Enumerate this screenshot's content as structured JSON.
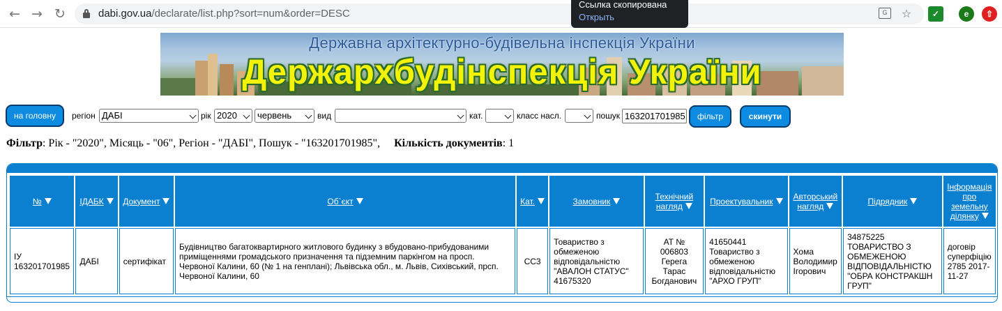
{
  "browser": {
    "url_host": "dabi.gov.ua",
    "url_path": "/declarate/list.php?sort=num&order=DESC",
    "toast_title": "Ссылка скопирована",
    "toast_action": "Открыть",
    "profile_letter": "e"
  },
  "banner": {
    "subtitle": "Державна архітектурно-будівельна інспекція України",
    "title": "Держархбудінспекція України"
  },
  "filters": {
    "home_button": "на головну",
    "region_label": "регіон",
    "region_value": "ДАБІ",
    "year_label": "рік",
    "year_value": "2020",
    "month_value": "червень",
    "type_label": "вид",
    "type_value": "",
    "cat_label": "кат.",
    "cat_value": "",
    "class_label": "класс насл.",
    "class_value": "",
    "search_label": "пошук",
    "search_value": "163201701985",
    "filter_button": "фільтр",
    "reset_button": "скинути"
  },
  "summary": {
    "filter_label": "Фільтр",
    "filter_text": ": Рік - \"2020\", Місяць - \"06\", Регіон - \"ДАБІ\", Пошук - \"163201701985\",",
    "count_label": "Кількість документів",
    "count_text": ": 1"
  },
  "table": {
    "headers": {
      "num": "№",
      "idabk": "ІДАБК",
      "document": "Документ",
      "object": "Об`єкт",
      "cat": "Кат.",
      "customer": "Замовник",
      "tech_l1": "Технічний",
      "tech_l2": "нагляд",
      "designer": "Проектувальник",
      "author_l1": "Авторський",
      "author_l2": "нагляд",
      "contractor": "Підрядник",
      "land_l1": "Інформація",
      "land_l2": "про",
      "land_l3": "земельну",
      "land_l4": "ділянку"
    },
    "rows": [
      {
        "num_l1": "ІУ",
        "num_l2": "163201701985",
        "idabk": "ДАБІ",
        "document": "сертифікат",
        "object": "Будівництво багатоквартирного житлового будинку з вбудовано-прибудованими приміщеннями громадського призначення та підземним паркінгом на просп. Червоної Калини, 60 (№ 1 на генплані); Львівська обл., м. Львів, Сихівський, прсп. Червоної Калини, 60",
        "cat": "СС3",
        "customer": "Товариство з обмеженою відповідальністю \"АВАЛОН СТАТУС\" 41675320",
        "tech": "АТ № 006803 Герега Тарас Богданович",
        "designer_l1": "41650441",
        "designer_l2": "Товариство з обмеженою відповідальністю \"АРХО ГРУП\"",
        "author": "Хома Володимир Ігорович",
        "contractor_l1": "34875225",
        "contractor_l2": "ТОВАРИСТВО З ОБМЕЖЕНОЮ ВІДПОВІДАЛЬНІСТЮ \"ОБРА КОНСТРАКШН ГРУП\"",
        "land": "договір суперфіцію 2785 2017-11-27"
      }
    ]
  }
}
